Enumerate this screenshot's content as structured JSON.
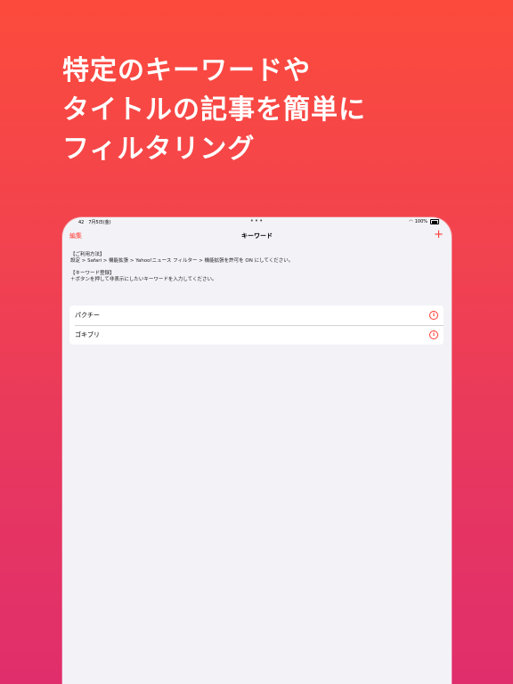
{
  "headline": {
    "lines": [
      "特定のキーワードや",
      "タイトルの記事を簡単に",
      "フィルタリング"
    ]
  },
  "status_bar": {
    "time": "42　7月5日(金)",
    "battery": "100%"
  },
  "nav": {
    "edit_label": "編集",
    "title": "キーワード",
    "add_label": "+"
  },
  "help": {
    "usage_heading": "【ご利用方法】",
    "usage_text": "設定 > Safari > 機能拡張 > Yahoo!ニュース フィルター > 機能拡張を許可を ON にしてください。",
    "register_heading": "【キーワード登録】",
    "register_text": "＋ボタンを押して非表示にしたいキーワードを入力してください。"
  },
  "keywords": [
    {
      "label": "パクチー"
    },
    {
      "label": "ゴキブリ"
    }
  ],
  "colors": {
    "accent": "#ff3b30",
    "background_top": "#fc4b3c",
    "background_bottom": "#e02e6c"
  }
}
